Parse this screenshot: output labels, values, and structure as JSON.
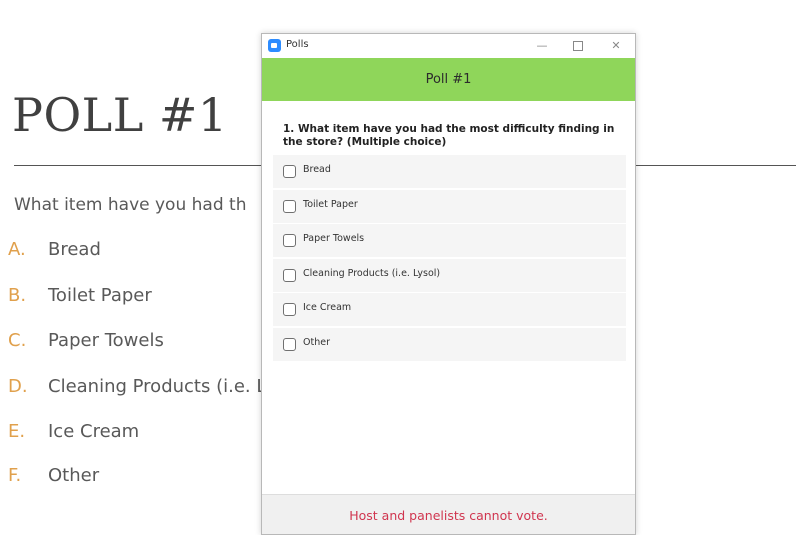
{
  "slide": {
    "title": "POLL #1",
    "question": "What item have you had th",
    "options": [
      {
        "letter": "A.",
        "text": "Bread"
      },
      {
        "letter": "B.",
        "text": "Toilet Paper"
      },
      {
        "letter": "C.",
        "text": "Paper Towels"
      },
      {
        "letter": "D.",
        "text": "Cleaning Products (i.e. L"
      },
      {
        "letter": "E.",
        "text": "Ice Cream"
      },
      {
        "letter": "F.",
        "text": "Other"
      }
    ]
  },
  "window": {
    "title": "Polls",
    "app_icon": "zoom-app-icon",
    "controls": {
      "minimize": "—",
      "maximize": "",
      "close": "✕"
    }
  },
  "poll": {
    "header": "Poll #1",
    "question": "1. What item have you had the most difficulty finding in the store? (Multiple choice)",
    "options": [
      {
        "label": "Bread",
        "checked": false
      },
      {
        "label": "Toilet Paper",
        "checked": false
      },
      {
        "label": "Paper Towels",
        "checked": false
      },
      {
        "label": "Cleaning Products (i.e. Lysol)",
        "checked": false
      },
      {
        "label": "Ice Cream",
        "checked": false
      },
      {
        "label": "Other",
        "checked": false
      }
    ],
    "footer_message": "Host and panelists cannot vote."
  },
  "colors": {
    "header_green": "#8fd65a",
    "footer_text": "#d0354f",
    "slide_letter": "#e0a04c",
    "zoom_blue": "#2d8cff"
  }
}
